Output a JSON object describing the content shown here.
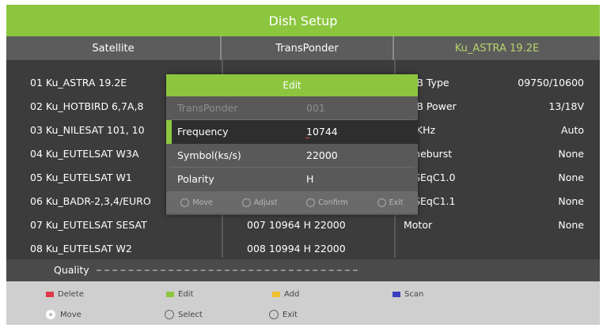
{
  "title": "Dish Setup",
  "headers": {
    "satellite": "Satellite",
    "transponder": "TransPonder",
    "current_satellite": "Ku_ASTRA 19.2E"
  },
  "satellites": [
    "01 Ku_ASTRA 19.2E",
    "02 Ku_HOTBIRD 6,7A,8",
    "03 Ku_NILESAT 101, 10",
    "04 Ku_EUTELSAT W3A",
    "05 Ku_EUTELSAT W1",
    "06 Ku_BADR-2,3,4/EURO",
    "07 Ku_EUTELSAT SESAT",
    "08 Ku_EUTELSAT W2"
  ],
  "transponders": [
    "007 10964 H 22000",
    "008 10994 H 22000"
  ],
  "params": [
    {
      "label": "LNB Type",
      "value": "09750/10600"
    },
    {
      "label": "LNB Power",
      "value": "13/18V"
    },
    {
      "label": "22KHz",
      "value": "Auto"
    },
    {
      "label": "Toneburst",
      "value": "None"
    },
    {
      "label": "DiSEqC1.0",
      "value": "None"
    },
    {
      "label": "DiSEqC1.1",
      "value": "None"
    },
    {
      "label": "Motor",
      "value": "None"
    }
  ],
  "quality_label": "Quality",
  "edit_dialog": {
    "title": "Edit",
    "rows": [
      {
        "label": "TransPonder",
        "value": "001"
      },
      {
        "label": "Frequency",
        "value": "10744"
      },
      {
        "label": "Symbol(ks/s)",
        "value": "22000"
      },
      {
        "label": "Polarity",
        "value": "H"
      }
    ],
    "help": [
      "Move",
      "Adjust",
      "Confirm",
      "Exit"
    ]
  },
  "footer": {
    "delete": "Delete",
    "edit": "Edit",
    "add": "Add",
    "scan": "Scan",
    "move": "Move",
    "select": "Select",
    "exit": "Exit"
  },
  "colors": {
    "accent_green": "#8cc63f",
    "red_key": "#e03a4a",
    "green_key": "#8cc63f",
    "yellow_key": "#f2c12e",
    "blue_key": "#3b3fbf"
  }
}
